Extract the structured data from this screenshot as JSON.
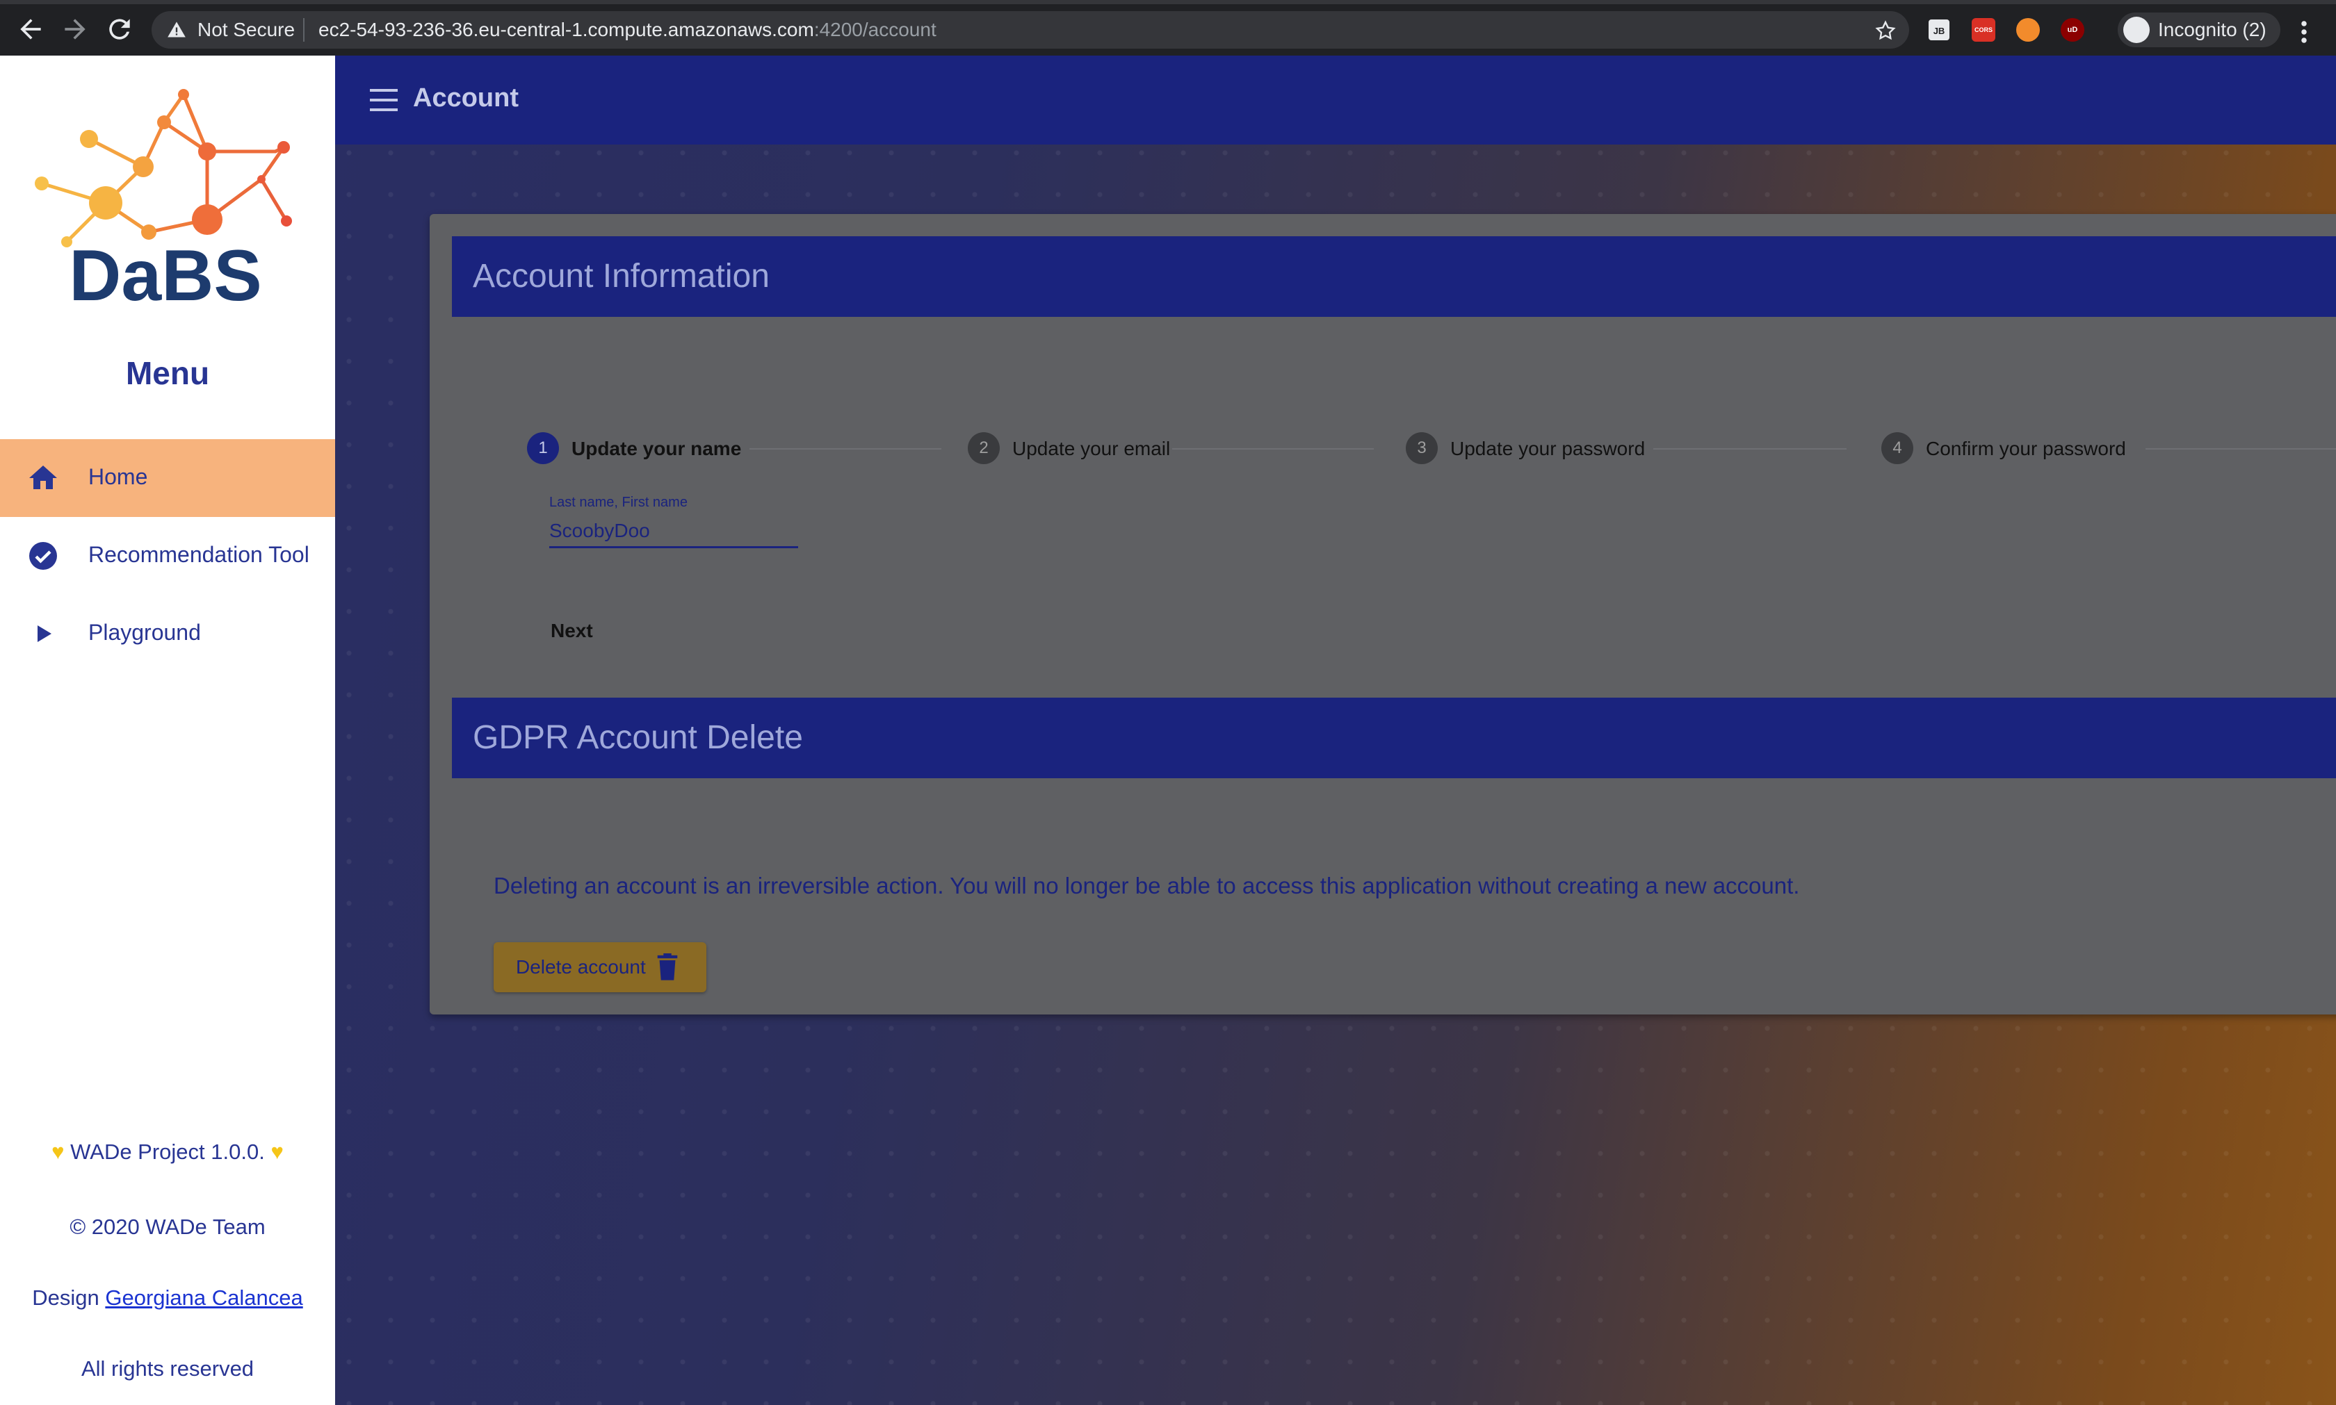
{
  "browser": {
    "security_label": "Not Secure",
    "url_host": "ec2-54-93-236-36.eu-central-1.compute.amazonaws.com",
    "url_path": ":4200/account",
    "profile_label": "Incognito (2)",
    "extensions": [
      "JB",
      "CORS",
      "basketball",
      "uD"
    ]
  },
  "sidebar": {
    "logo_text": "DaBS",
    "menu_title": "Menu",
    "items": [
      {
        "label": "Home",
        "icon": "home-icon",
        "active": true
      },
      {
        "label": "Recommendation Tool",
        "icon": "check-circle-icon",
        "active": false
      },
      {
        "label": "Playground",
        "icon": "play-icon",
        "active": false
      }
    ],
    "footer": {
      "version": "WADe Project 1.0.0.",
      "copyright": "© 2020 WADe Team",
      "design_prefix": "Design",
      "designer": "Georgiana Calancea",
      "rights": "All rights reserved"
    }
  },
  "topbar": {
    "title": "Account"
  },
  "account_info": {
    "header": "Account Information",
    "steps": [
      {
        "number": "1",
        "label": "Update your name",
        "active": true
      },
      {
        "number": "2",
        "label": "Update your email",
        "active": false
      },
      {
        "number": "3",
        "label": "Update your password",
        "active": false
      },
      {
        "number": "4",
        "label": "Confirm your password",
        "active": false
      }
    ],
    "name_field": {
      "label": "Last name, First name",
      "value": "ScoobyDoo"
    },
    "next_label": "Next"
  },
  "gdpr": {
    "header": "GDPR Account Delete",
    "warning": "Deleting an account is an irreversible action. You will no longer be able to access this application without creating a new account.",
    "delete_label": "Delete account"
  },
  "colors": {
    "primary": "#1a237e",
    "accent": "#f7b37d",
    "warn_button": "#8a6a24"
  }
}
